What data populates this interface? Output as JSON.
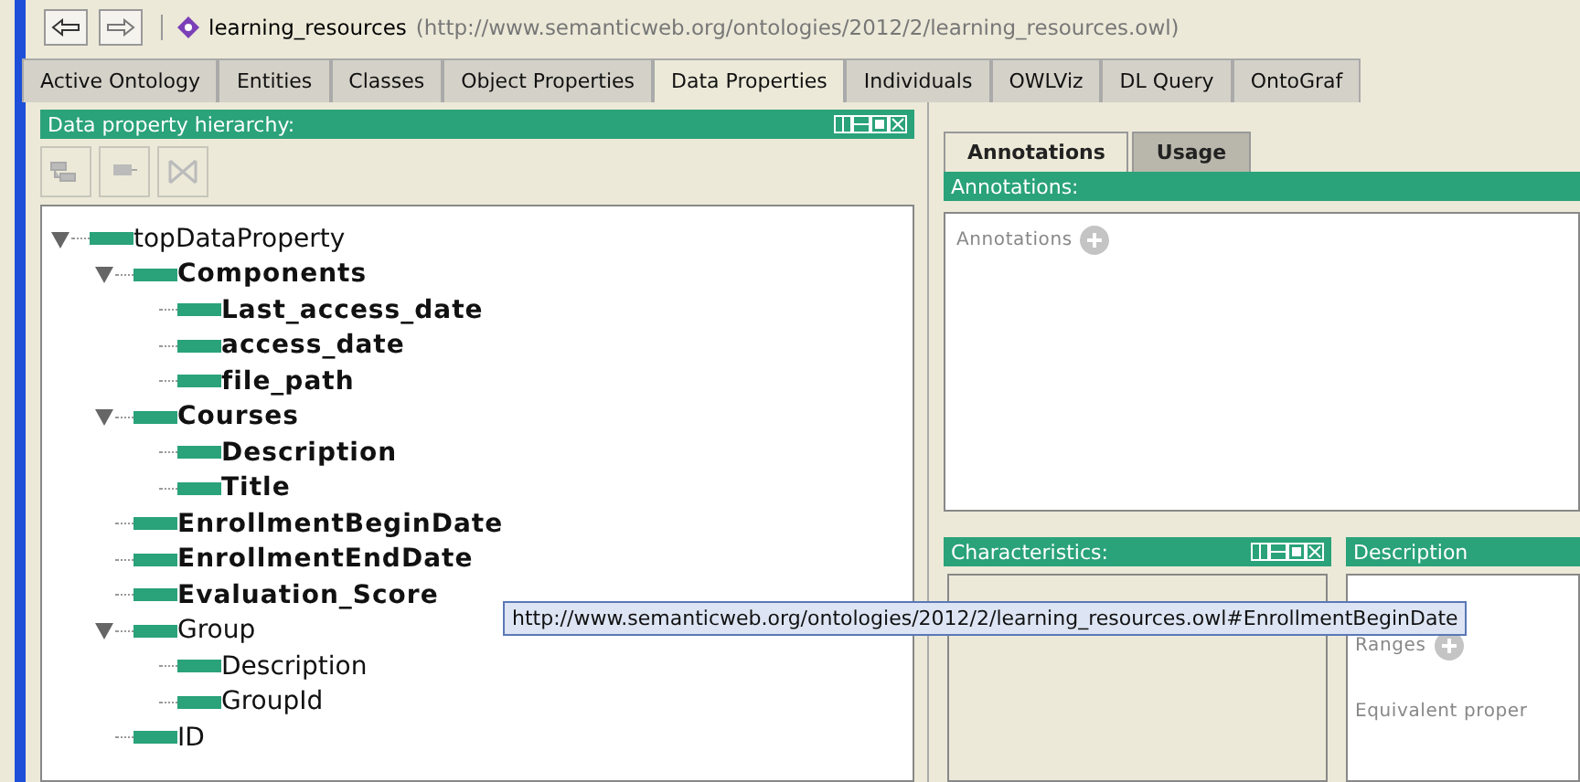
{
  "navigation": {
    "ontology_name": "learning_resources",
    "ontology_iri": "(http://www.semanticweb.org/ontologies/2012/2/learning_resources.owl)"
  },
  "tabs": [
    {
      "label": "Active Ontology",
      "selected": false
    },
    {
      "label": "Entities",
      "selected": false
    },
    {
      "label": "Classes",
      "selected": false
    },
    {
      "label": "Object Properties",
      "selected": false
    },
    {
      "label": "Data Properties",
      "selected": true
    },
    {
      "label": "Individuals",
      "selected": false
    },
    {
      "label": "OWLViz",
      "selected": false
    },
    {
      "label": "DL Query",
      "selected": false
    },
    {
      "label": "OntoGraf",
      "selected": false
    }
  ],
  "hierarchy": {
    "title": "Data property hierarchy:",
    "tree": [
      {
        "label": "topDataProperty",
        "bold": false,
        "expanded": true,
        "children": [
          {
            "label": "Components",
            "bold": true,
            "expanded": true,
            "children": [
              {
                "label": "Last_access_date",
                "bold": true
              },
              {
                "label": "access_date",
                "bold": true
              },
              {
                "label": "file_path",
                "bold": true
              }
            ]
          },
          {
            "label": "Courses",
            "bold": true,
            "expanded": true,
            "children": [
              {
                "label": "Description",
                "bold": true
              },
              {
                "label": "Title",
                "bold": true
              }
            ]
          },
          {
            "label": "EnrollmentBeginDate",
            "bold": true
          },
          {
            "label": "EnrollmentEndDate",
            "bold": true
          },
          {
            "label": "Evaluation_Score",
            "bold": true
          },
          {
            "label": "Group",
            "bold": false,
            "expanded": true,
            "children": [
              {
                "label": "Description",
                "bold": false
              },
              {
                "label": "GroupId",
                "bold": false
              }
            ]
          },
          {
            "label": "ID",
            "bold": false
          }
        ]
      }
    ]
  },
  "detail_tabs": [
    {
      "label": "Annotations",
      "selected": true
    },
    {
      "label": "Usage",
      "selected": false
    }
  ],
  "annotations": {
    "title": "Annotations:",
    "section": "Annotations"
  },
  "characteristics": {
    "title": "Characteristics:"
  },
  "description": {
    "title": "Description",
    "sections": [
      "Ranges",
      "Equivalent proper"
    ]
  },
  "tooltip": "http://www.semanticweb.org/ontologies/2012/2/learning_resources.owl#EnrollmentBeginDate"
}
